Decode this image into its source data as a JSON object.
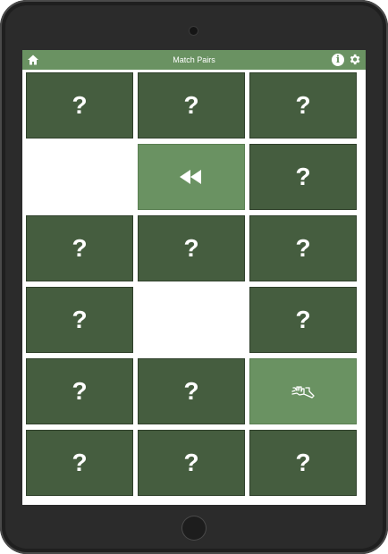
{
  "app": {
    "title": "Match Pairs"
  },
  "appbar": {
    "home_icon": "home-icon",
    "info_icon": "info-icon",
    "info_glyph": "i",
    "settings_icon": "gear-icon"
  },
  "cards": [
    {
      "state": "hidden",
      "label": "?"
    },
    {
      "state": "hidden",
      "label": "?"
    },
    {
      "state": "hidden",
      "label": "?"
    },
    {
      "state": "empty",
      "label": ""
    },
    {
      "state": "revealed",
      "icon": "rewind-icon"
    },
    {
      "state": "hidden",
      "label": "?"
    },
    {
      "state": "hidden",
      "label": "?"
    },
    {
      "state": "hidden",
      "label": "?"
    },
    {
      "state": "hidden",
      "label": "?"
    },
    {
      "state": "hidden",
      "label": "?"
    },
    {
      "state": "empty",
      "label": ""
    },
    {
      "state": "hidden",
      "label": "?"
    },
    {
      "state": "hidden",
      "label": "?"
    },
    {
      "state": "hidden",
      "label": "?"
    },
    {
      "state": "revealed",
      "icon": "pinch-gesture-icon"
    },
    {
      "state": "hidden",
      "label": "?"
    },
    {
      "state": "hidden",
      "label": "?"
    },
    {
      "state": "hidden",
      "label": "?"
    }
  ],
  "colors": {
    "appbar": "#6a9262",
    "card_hidden": "#455d3f",
    "card_revealed": "#6a9262"
  }
}
